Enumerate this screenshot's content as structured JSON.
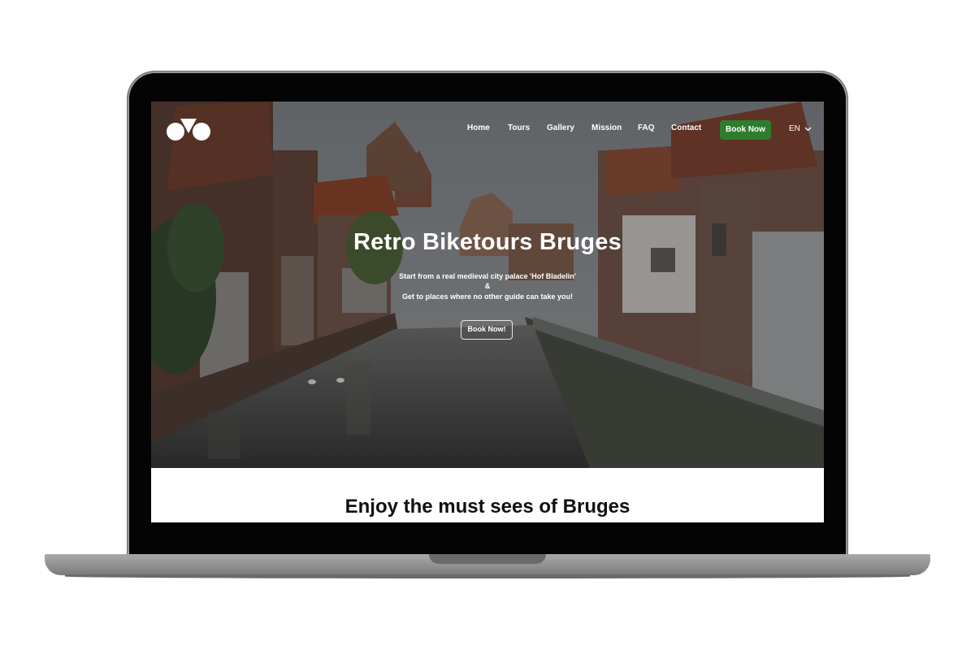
{
  "site": {
    "nav": {
      "items": [
        {
          "label": "Home"
        },
        {
          "label": "Tours"
        },
        {
          "label": "Gallery"
        },
        {
          "label": "Mission"
        },
        {
          "label": "FAQ"
        },
        {
          "label": "Contact"
        }
      ],
      "book_button": "Book Now",
      "language": "EN"
    },
    "hero": {
      "title": "Retro Biketours Bruges",
      "subtitle_line1": "Start from a real medieval city palace 'Hof Bladelin'",
      "subtitle_line2": "&",
      "subtitle_line3": "Get to places where no other guide can take you!",
      "cta": "Book Now!"
    },
    "section": {
      "title": "Enjoy the must sees of Bruges"
    }
  },
  "colors": {
    "accent_green": "#2e7d2e",
    "laptop_bezel": "#040404",
    "laptop_base": "#959595"
  },
  "icons": {
    "logo": "bike-logo-icon",
    "language_caret": "chevron-down-icon"
  }
}
